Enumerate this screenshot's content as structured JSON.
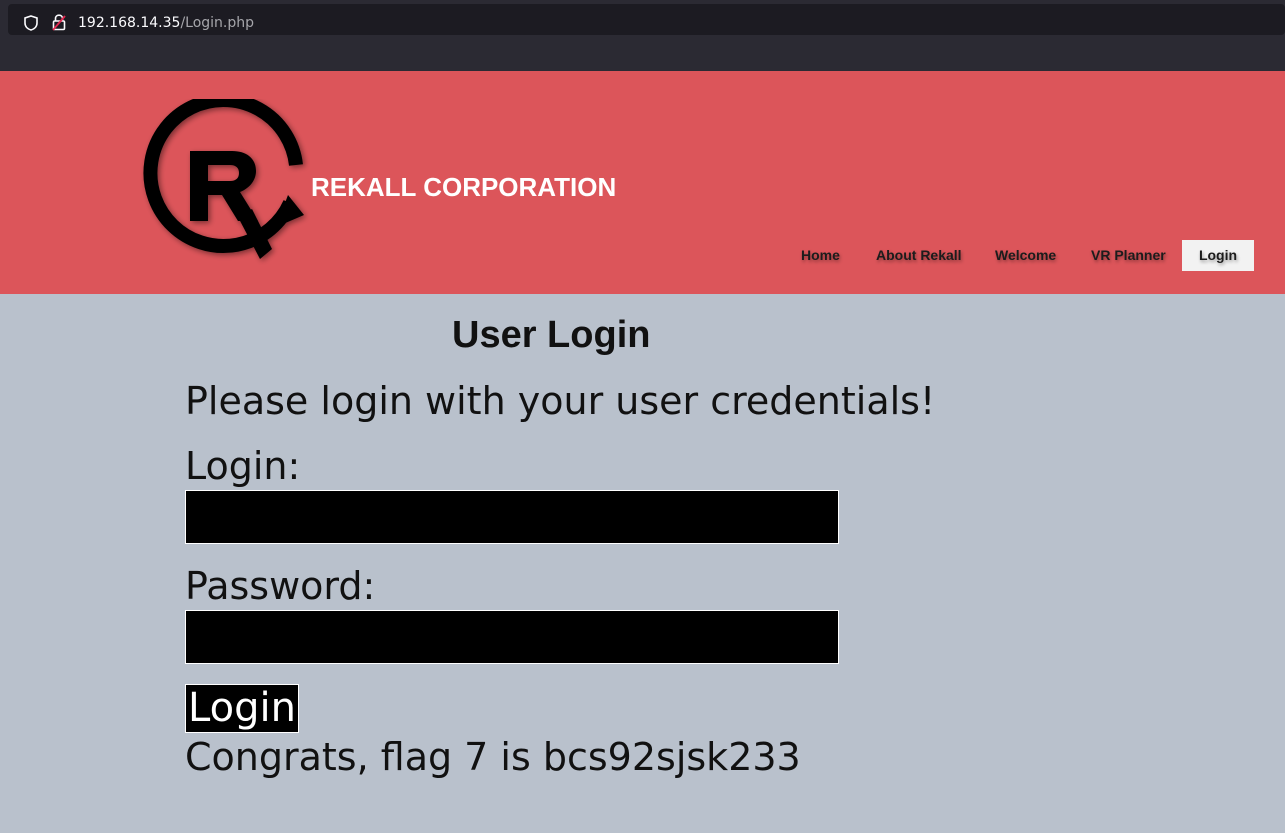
{
  "browser": {
    "url_host": "192.168.14.35",
    "url_path": "/Login.php",
    "icons": [
      "shield-icon",
      "insecure-lock-icon"
    ]
  },
  "header": {
    "logo_icon": "rekall-r-logo",
    "brand": "REKALL CORPORATION",
    "background_color": "#dc555a",
    "nav": [
      {
        "label": "Home",
        "active": false
      },
      {
        "label": "About Rekall",
        "active": false
      },
      {
        "label": "Welcome",
        "active": false
      },
      {
        "label": "VR Planner",
        "active": false
      },
      {
        "label": "Login",
        "active": true
      }
    ]
  },
  "main": {
    "title": "User Login",
    "instructions": "Please login with your user credentials!",
    "login_label": "Login:",
    "login_value": "",
    "password_label": "Password:",
    "password_value": "",
    "submit_label": "Login",
    "message": "Congrats, flag 7 is bcs92sjsk233",
    "background_color": "#b9c1cc"
  }
}
